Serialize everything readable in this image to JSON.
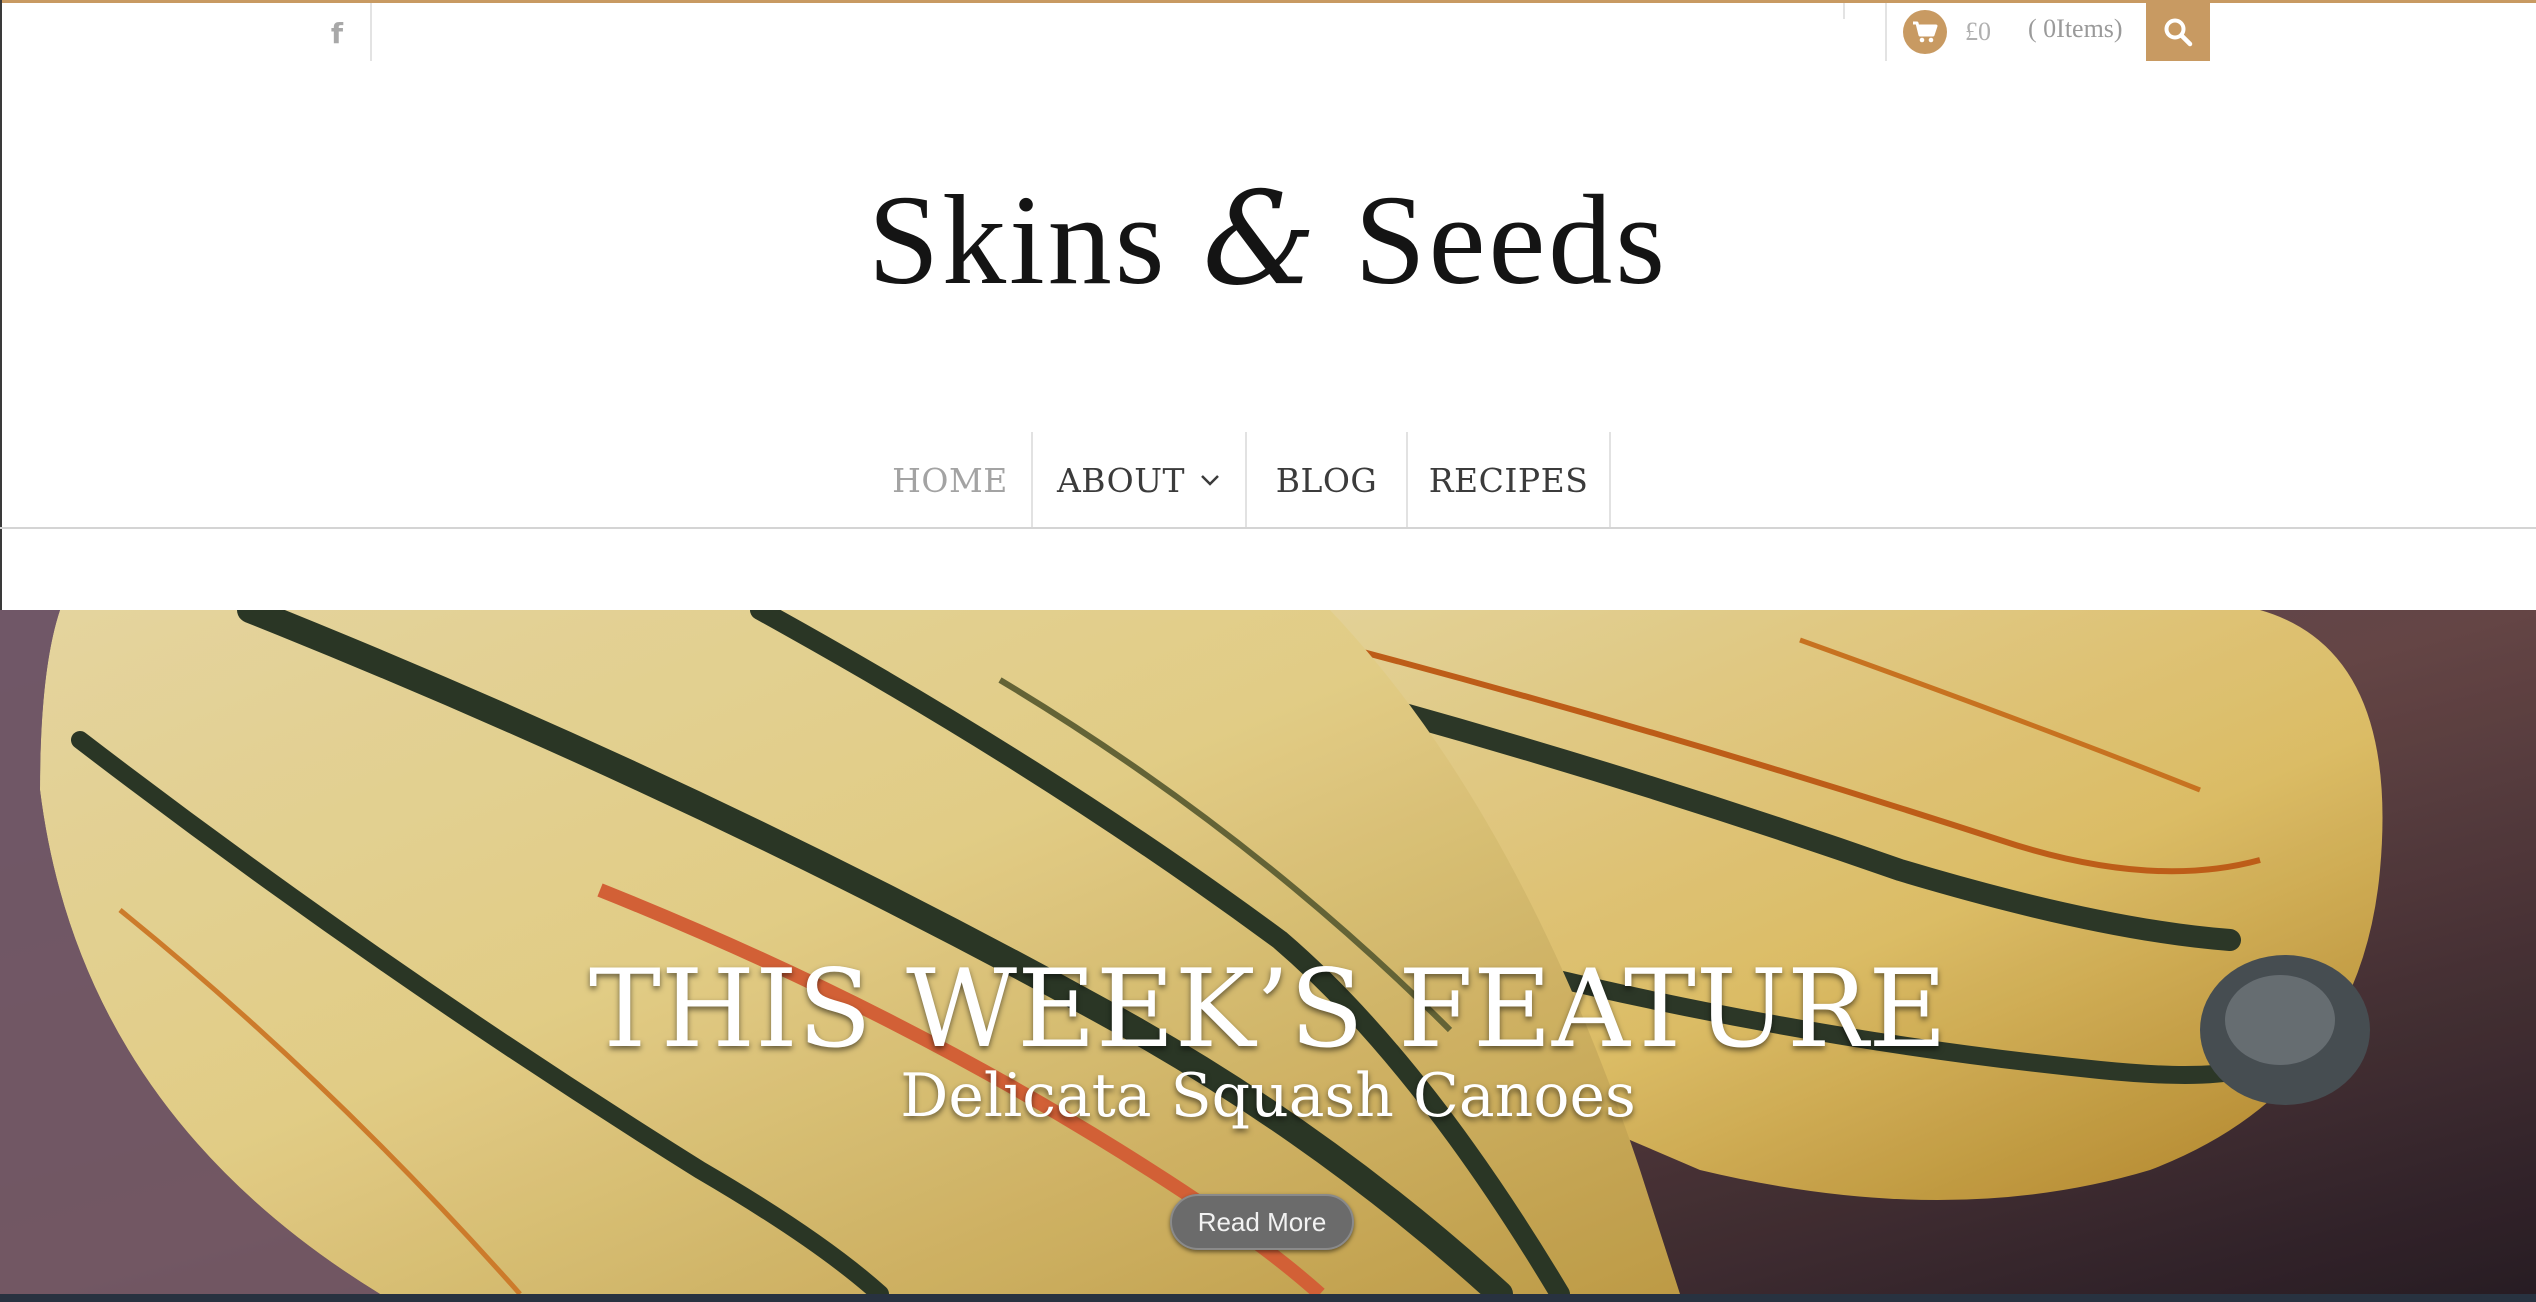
{
  "topbar": {
    "cart_price": "£0",
    "cart_items": "( 0Items)",
    "accent_color": "#c89a62"
  },
  "icons": {
    "social": "facebook-icon",
    "cart": "shopping-cart-icon",
    "search": "search-icon",
    "dropdown": "chevron-down-icon"
  },
  "logo": {
    "part1": "Skins",
    "amp": "&",
    "part2": "Seeds"
  },
  "nav": {
    "items": [
      {
        "label": "HOME",
        "active": true
      },
      {
        "label": "ABOUT",
        "has_dropdown": true
      },
      {
        "label": "BLOG"
      },
      {
        "label": "RECIPES"
      }
    ]
  },
  "hero": {
    "title": "THIS WEEK’S FEATURE",
    "subtitle": "Delicata Squash Canoes",
    "button_label": "Read More"
  }
}
